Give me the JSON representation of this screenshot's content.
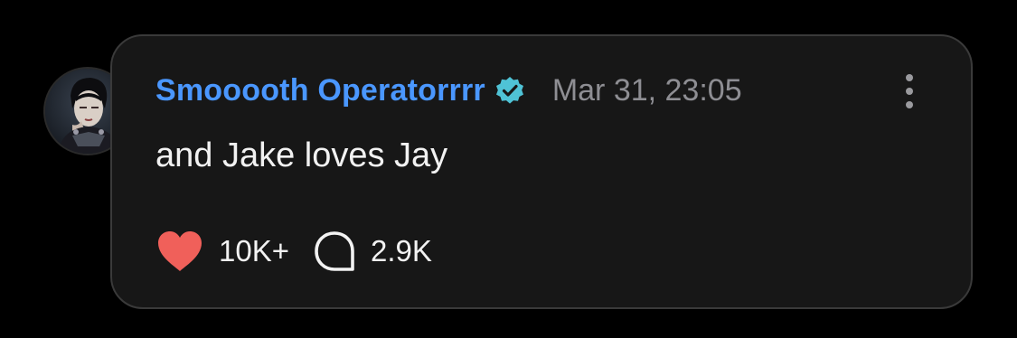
{
  "post": {
    "author": "Smooooth Operatorrrr",
    "timestamp": "Mar 31, 23:05",
    "text": "and Jake loves Jay",
    "likes": "10K+",
    "comments": "2.9K"
  },
  "icons": {
    "verified": "verified-badge-icon",
    "more": "more-vertical-icon",
    "like": "heart-icon",
    "comment": "comment-bubble-icon"
  },
  "colors": {
    "background": "#000000",
    "card": "#171717",
    "author": "#4a97ff",
    "verified": "#4fc3d6",
    "heart": "#f0605a",
    "timestamp": "#8e8e93"
  }
}
